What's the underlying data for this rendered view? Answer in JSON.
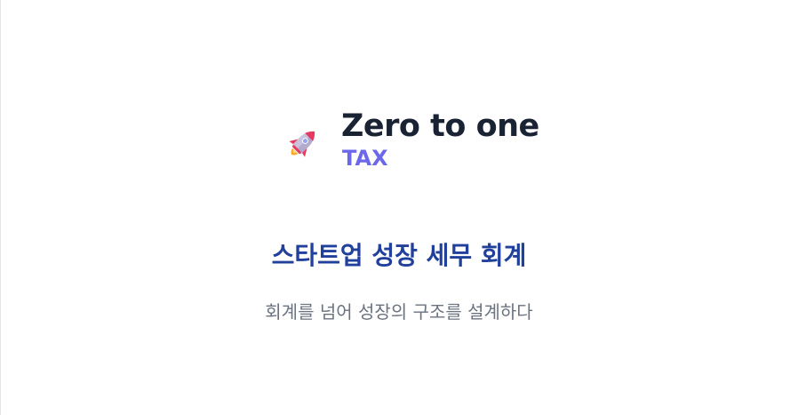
{
  "logo": {
    "icon": "rocket-icon",
    "name": "Zero to one",
    "tax": "TAX"
  },
  "hero": {
    "headline": "스타트업 성장 세무 회계",
    "subtitle": "회계를 넘어 성장의 구조를 설계하다"
  },
  "colors": {
    "background": "#ffffff",
    "brand_text": "#1a2333",
    "tax_accent": "#6b68ea",
    "headline": "#21409c",
    "subtitle": "#6c7380",
    "rocket_body": "#c9c3dd",
    "rocket_red": "#e63a62",
    "rocket_window": "#8fa6e8",
    "rocket_flame": "#f5a623"
  }
}
